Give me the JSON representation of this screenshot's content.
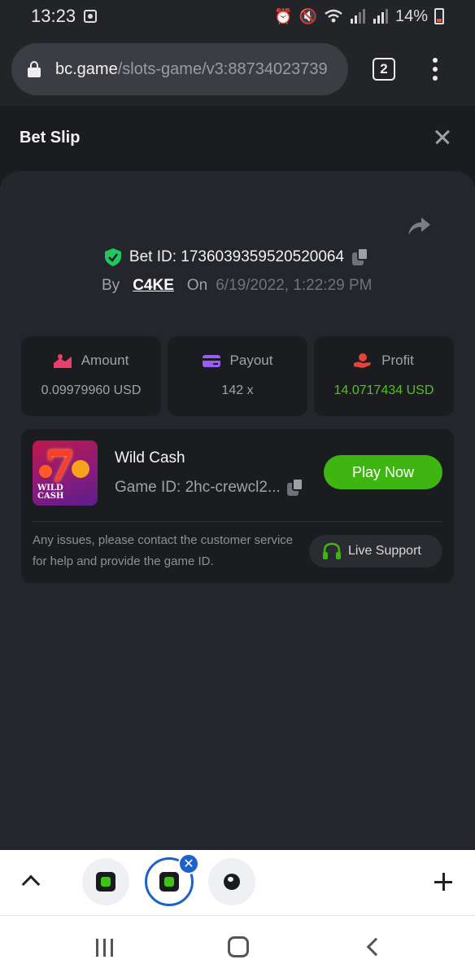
{
  "status_bar": {
    "time": "13:23",
    "battery": "14%",
    "icons": [
      "alarm-icon",
      "mute-icon",
      "wifi-icon",
      "signal-icon",
      "signal-icon",
      "battery-icon"
    ]
  },
  "browser": {
    "url_domain": "bc.game",
    "url_path": "/slots-game/v3:88734023739",
    "tab_count": "2"
  },
  "modal": {
    "title": "Bet Slip",
    "bet_id": "Bet ID: 1736039359520520064",
    "by_label": "By",
    "username": "C4KE",
    "on_label": "On",
    "date": "6/19/2022, 1:22:29 PM"
  },
  "stats": {
    "amount": {
      "label": "Amount",
      "value": "0.09979960 USD"
    },
    "payout": {
      "label": "Payout",
      "value": "142 x"
    },
    "profit": {
      "label": "Profit",
      "value": "14.0717434 USD"
    }
  },
  "game": {
    "name": "Wild Cash",
    "game_id": "Game ID: 2hc-crewcl2...",
    "play_label": "Play Now",
    "thumb_text_line1": "WILD",
    "thumb_text_line2": "CASH",
    "support_text": "Any issues, please contact the customer service for help and provide the game ID.",
    "support_label": "Live Support"
  },
  "colors": {
    "accent_green": "#3fb512",
    "profit_green": "#4fc416",
    "shield_green": "#22c55e",
    "active_tab_blue": "#1c62c8"
  }
}
